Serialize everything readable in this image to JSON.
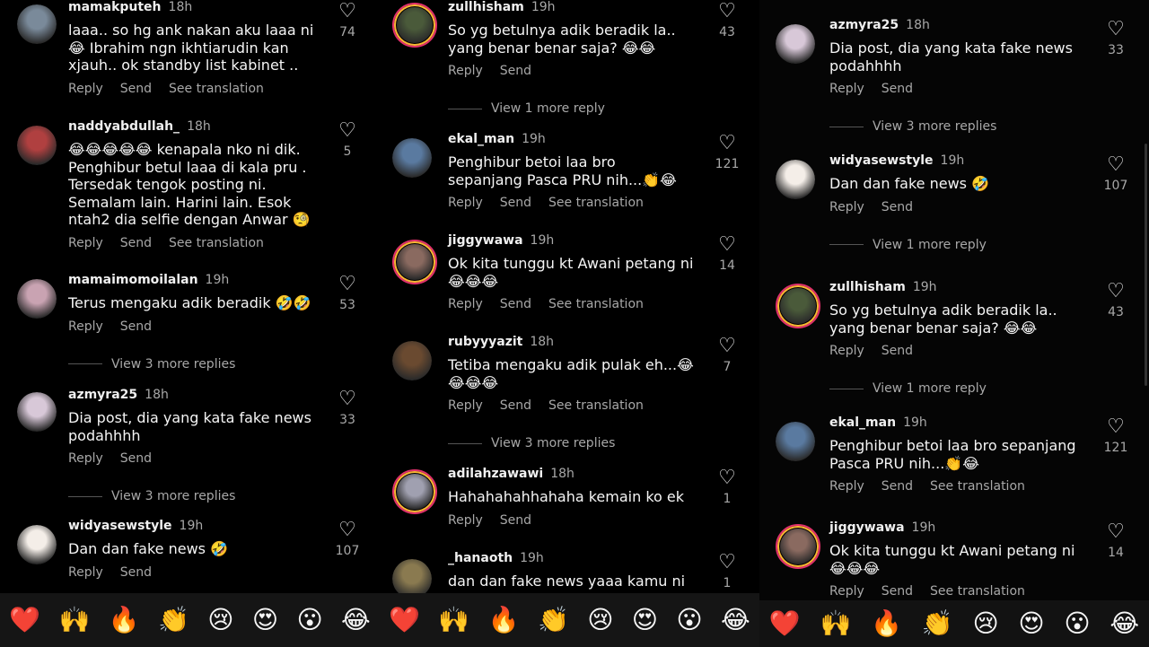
{
  "panel1": [
    {
      "user": "mamakputeh",
      "time": "18h",
      "text": "laaa.. so hg ank nakan aku laaa ni😂 Ibrahim ngn ikhtiarudin kan xjauh.. ok standby list kabinet ..",
      "likes": "74",
      "actions": [
        "Reply",
        "Send",
        "See translation"
      ],
      "color": "#7a8a9a"
    },
    {
      "user": "naddyabdullah_",
      "time": "18h",
      "text": "😂😂😂😂😂 kenapala nko ni dik. Penghibur betul laaa di kala pru . Tersedak tengok posting ni. Semalam lain. Harini lain. Esok ntah2 dia selfie dengan Anwar 🧐",
      "likes": "5",
      "actions": [
        "Reply",
        "Send",
        "See translation"
      ],
      "color": "#b04040"
    },
    {
      "user": "mamaimomoilalan",
      "time": "19h",
      "text": "Terus mengaku adik beradik 🤣🤣",
      "likes": "53",
      "actions": [
        "Reply",
        "Send"
      ],
      "color": "#c9a3b2",
      "more": "View 3 more replies"
    },
    {
      "user": "azmyra25",
      "time": "18h",
      "text": "Dia post, dia yang kata fake news podahhhh",
      "likes": "33",
      "actions": [
        "Reply",
        "Send"
      ],
      "color": "#d8c8d8",
      "more": "View 3 more replies"
    },
    {
      "user": "widyasewstyle",
      "time": "19h",
      "text": "Dan dan fake news 🤣",
      "likes": "107",
      "actions": [
        "Reply",
        "Send"
      ],
      "color": "#f4eee8"
    }
  ],
  "panel2": [
    {
      "user": "zullhisham",
      "time": "19h",
      "text": "So yg betulnya adik beradik la.. yang benar benar saja? 😂😂",
      "likes": "43",
      "actions": [
        "Reply",
        "Send"
      ],
      "color": "#4a5a3a",
      "more": "View 1 more reply"
    },
    {
      "user": "ekal_man",
      "time": "19h",
      "text": "Penghibur betoi laa bro sepanjang Pasca PRU nih...👏😂",
      "likes": "121",
      "actions": [
        "Reply",
        "Send",
        "See translation"
      ],
      "color": "#5a7aa0"
    },
    {
      "user": "jiggywawa",
      "time": "19h",
      "text": "Ok kita tunggu kt Awani petang ni 😂😂😂",
      "likes": "14",
      "actions": [
        "Reply",
        "Send",
        "See translation"
      ],
      "color": "#8a6a60"
    },
    {
      "user": "rubyyyazit",
      "time": "18h",
      "text": "Tetiba mengaku adik pulak eh...😂😂😂😂",
      "likes": "7",
      "actions": [
        "Reply",
        "Send",
        "See translation"
      ],
      "color": "#6a4a30",
      "more": "View 3 more replies"
    },
    {
      "user": "adilahzawawi",
      "time": "18h",
      "text": "Hahahahahhahaha kemain ko ek",
      "likes": "1",
      "actions": [
        "Reply",
        "Send"
      ],
      "color": "#a0a0b0"
    },
    {
      "user": "_hanaoth",
      "time": "19h",
      "text": "dan dan fake news yaaa kamu ni",
      "likes": "1",
      "actions": [],
      "color": "#8a7a50"
    }
  ],
  "panel3": [
    {
      "user": "azmyra25",
      "time": "18h",
      "text": "Dia post, dia yang kata fake news podahhhh",
      "likes": "33",
      "actions": [
        "Reply",
        "Send"
      ],
      "color": "#d8c8d8",
      "more": "View 3 more replies"
    },
    {
      "user": "widyasewstyle",
      "time": "19h",
      "text": "Dan dan fake news 🤣",
      "likes": "107",
      "actions": [
        "Reply",
        "Send"
      ],
      "color": "#f4eee8",
      "more": "View 1 more reply"
    },
    {
      "user": "zullhisham",
      "time": "19h",
      "text": "So yg betulnya adik beradik la.. yang benar benar saja? 😂😂",
      "likes": "43",
      "actions": [
        "Reply",
        "Send"
      ],
      "color": "#4a5a3a",
      "more": "View 1 more reply"
    },
    {
      "user": "ekal_man",
      "time": "19h",
      "text": "Penghibur betoi laa bro sepanjang Pasca PRU nih...👏😂",
      "likes": "121",
      "actions": [
        "Reply",
        "Send",
        "See translation"
      ],
      "color": "#5a7aa0"
    },
    {
      "user": "jiggywawa",
      "time": "19h",
      "text": "Ok kita tunggu kt Awani petang ni 😂😂😂",
      "likes": "14",
      "actions": [
        "Reply",
        "Send",
        "See translation"
      ],
      "color": "#8a6a60"
    }
  ],
  "emoji_bar_1": [
    "❤️",
    "🙌",
    "🔥",
    "👏",
    "😢",
    "😍",
    "😮",
    "😂",
    "❤️",
    "🙌",
    "🔥",
    "👏",
    "😢",
    "😍",
    "😮",
    "😂"
  ],
  "emoji_bar_2": [
    "❤️",
    "🙌",
    "🔥",
    "👏",
    "😢",
    "😍",
    "😮",
    "😂"
  ],
  "icons": {
    "heart": "heart-icon"
  }
}
